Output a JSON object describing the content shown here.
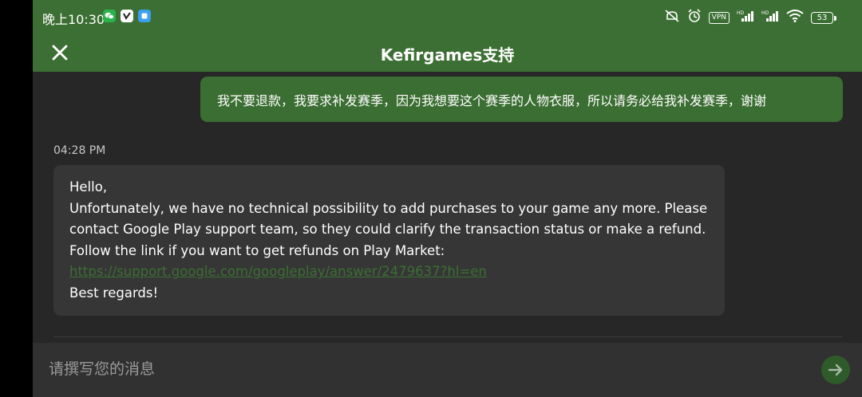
{
  "status_bar": {
    "time": "晚上10:30",
    "notification_icons": [
      "wechat-icon",
      "v-app-icon",
      "blue-app-icon"
    ],
    "vpn_label": "VPN",
    "battery_level": "53",
    "indicators": [
      "alarm-off-icon",
      "alarm-icon",
      "signal-hd-icon",
      "signal-hd-icon",
      "wifi-icon"
    ]
  },
  "header": {
    "title": "Kefirgames支持",
    "close_icon": "close-icon",
    "color": "#3c6f33"
  },
  "messages": {
    "user_message": "我不要退款，我要求补发赛季，因为我想要这个赛季的人物衣服，所以请务必给我补发赛季，谢谢",
    "support_timestamp": "04:28 PM",
    "support_lines": {
      "line1": "Hello,",
      "line2": "Unfortunately, we have no technical possibility to add purchases to your game any more. Please",
      "line3": "contact Google Play support team, so they could clarify the transaction status or make a refund.",
      "line4": "Follow the link if you want to get refunds on Play Market:",
      "link": "https://support.google.com/googleplay/answer/2479637?hl=en",
      "line6": "Best regards!"
    }
  },
  "composer": {
    "placeholder": "请撰写您的消息",
    "value": "",
    "send_icon": "send-arrow-icon"
  },
  "colors": {
    "accent": "#3c6f33",
    "background": "#272727",
    "bubble_support": "#363636",
    "bubble_user": "#3b6e32"
  }
}
